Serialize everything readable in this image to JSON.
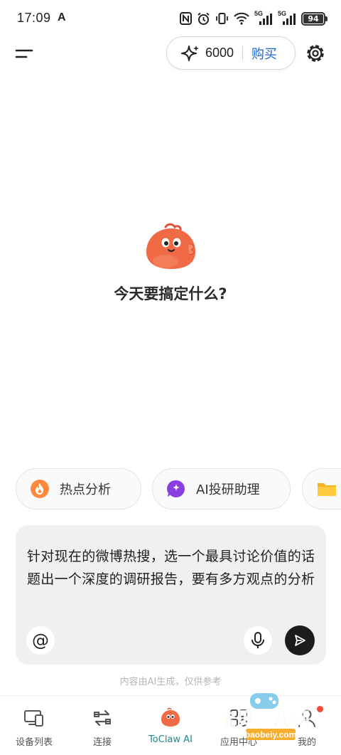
{
  "status_bar": {
    "time": "17:09",
    "carrier_icon_letter": "A",
    "network_1": "5G",
    "network_2": "5G",
    "battery": "94"
  },
  "header": {
    "credits": "6000",
    "buy_label": "购买"
  },
  "main": {
    "heading": "今天要搞定什么?"
  },
  "suggestions": [
    {
      "label": "热点分析",
      "icon": "flame-icon"
    },
    {
      "label": "AI投研助理",
      "icon": "sparkle-bubble-icon"
    },
    {
      "label": "",
      "icon": "folder-icon"
    }
  ],
  "input": {
    "text": "针对现在的微博热搜，选一个最具讨论价值的话题出一个深度的调研报告，要有多方观点的分析",
    "at_symbol": "@"
  },
  "disclaimer": "内容由AI生成，仅供参考",
  "bottom_nav": [
    {
      "label": "设备列表",
      "icon": "devices-icon",
      "active": false
    },
    {
      "label": "连接",
      "icon": "transfer-arrows-icon",
      "active": false
    },
    {
      "label": "ToClaw AI",
      "icon": "mascot-icon",
      "active": true
    },
    {
      "label": "应用中心",
      "icon": "app-center-icon",
      "active": false
    },
    {
      "label": "我的",
      "icon": "profile-icon",
      "active": false
    }
  ],
  "watermark": {
    "title": "宝贝游戏网",
    "url": "baobeiy.com"
  },
  "colors": {
    "accent_link": "#1b67d6",
    "active_tab": "#1d8a8a",
    "mascot": "#f06a45",
    "send_button": "#1c1c1c",
    "input_bg": "#f1f0ee"
  }
}
